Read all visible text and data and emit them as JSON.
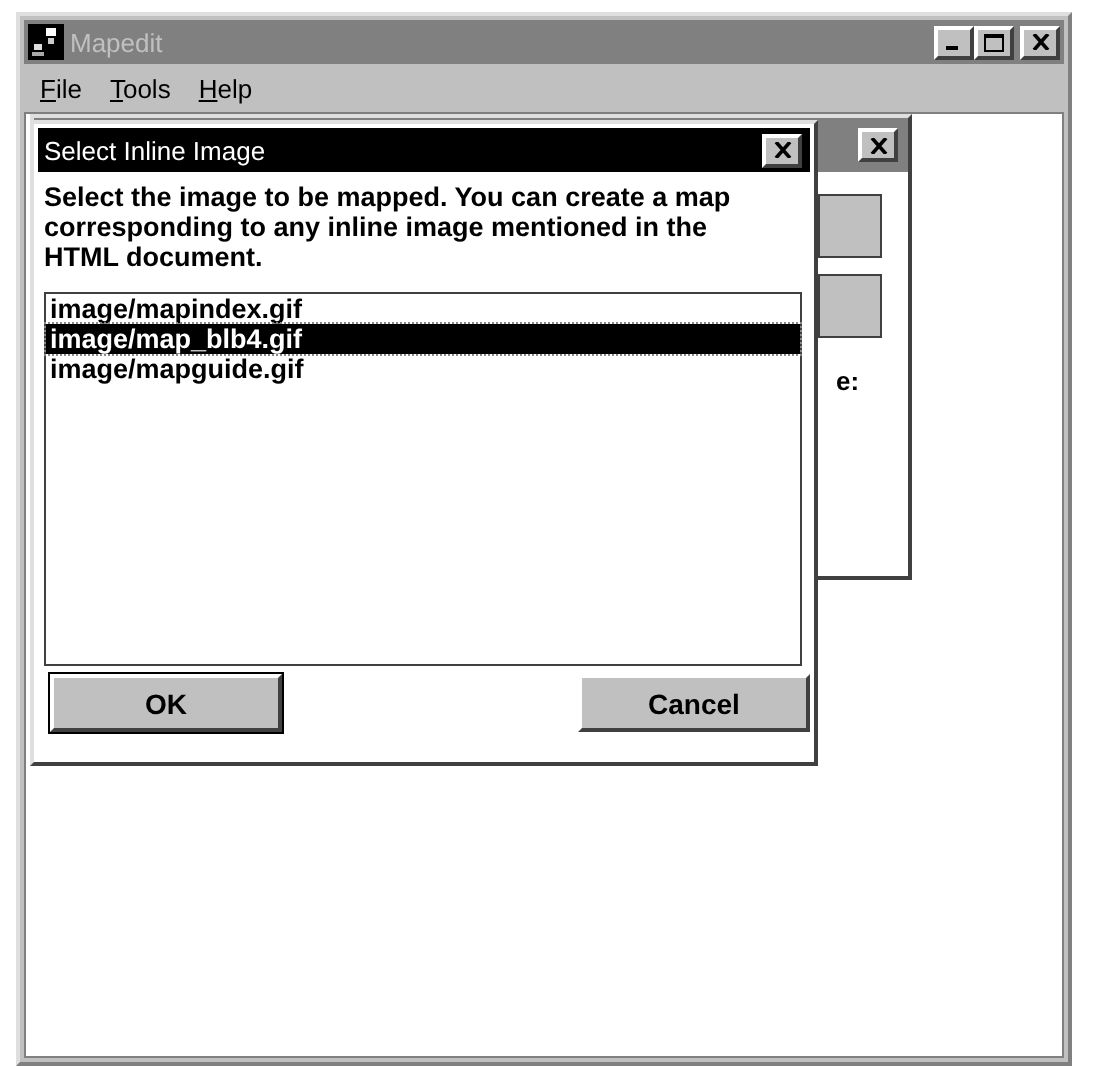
{
  "window": {
    "title": "Mapedit",
    "active": false
  },
  "menu": [
    {
      "label": "File",
      "underline_first": true
    },
    {
      "label": "Tools",
      "underline_first": true
    },
    {
      "label": "Help",
      "underline_first": true
    }
  ],
  "background_dialog": {
    "visible_text": "e:"
  },
  "dialog": {
    "title": "Select Inline Image",
    "message": "Select the image to be mapped. You can create a map corresponding to any inline image mentioned in the HTML document.",
    "images": [
      {
        "label": "image/mapindex.gif",
        "selected": false
      },
      {
        "label": "image/map_blb4.gif",
        "selected": true
      },
      {
        "label": "image/mapguide.gif",
        "selected": false
      }
    ],
    "buttons": [
      {
        "label": "OK",
        "default": true
      },
      {
        "label": "Cancel",
        "default": false
      }
    ]
  }
}
